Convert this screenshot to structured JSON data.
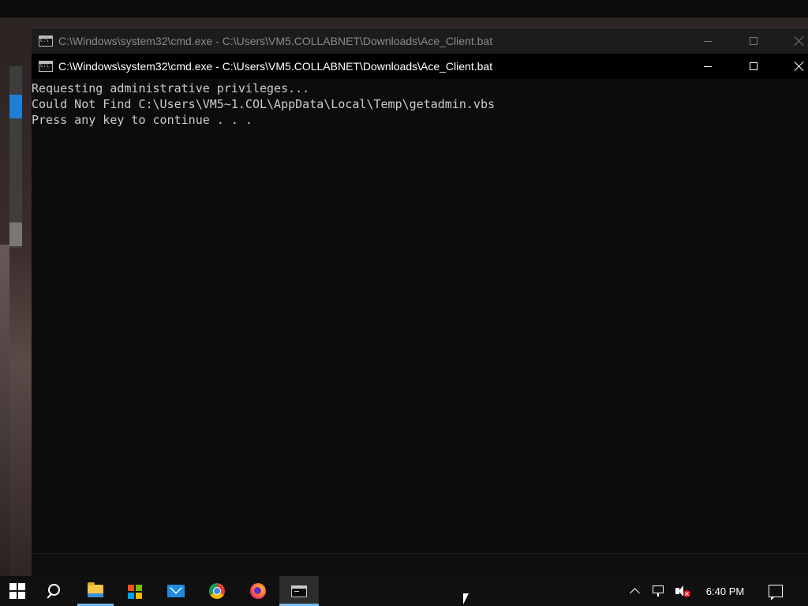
{
  "background_window": {
    "title": "C:\\Windows\\system32\\cmd.exe - C:\\Users\\VM5.COLLABNET\\Downloads\\Ace_Client.bat"
  },
  "window": {
    "title": "C:\\Windows\\system32\\cmd.exe - C:\\Users\\VM5.COLLABNET\\Downloads\\Ace_Client.bat",
    "icon": "cmd-icon",
    "controls": {
      "minimize": "minimize-icon",
      "maximize": "maximize-icon",
      "close": "close-icon"
    }
  },
  "console": {
    "lines": [
      "Requesting administrative privileges...",
      "Could Not Find C:\\Users\\VM5~1.COL\\AppData\\Local\\Temp\\getadmin.vbs",
      "Press any key to continue . . ."
    ],
    "background_color": "#0c0c0c",
    "text_color": "#cccccc"
  },
  "taskbar": {
    "items": [
      {
        "name": "start",
        "icon": "windows-logo-icon"
      },
      {
        "name": "search",
        "icon": "search-icon"
      },
      {
        "name": "file-explorer",
        "icon": "folder-icon",
        "open": true
      },
      {
        "name": "microsoft-store",
        "icon": "store-icon"
      },
      {
        "name": "mail",
        "icon": "mail-icon"
      },
      {
        "name": "chrome",
        "icon": "chrome-icon"
      },
      {
        "name": "firefox",
        "icon": "firefox-icon"
      },
      {
        "name": "command-prompt",
        "icon": "cmd-icon",
        "active": true
      }
    ],
    "tray": {
      "icons": [
        "chevron-up-icon",
        "network-icon",
        "volume-muted-icon"
      ],
      "clock": "6:40 PM",
      "notification_icon": "action-center-icon"
    },
    "accent_color": "#76b9ed"
  }
}
